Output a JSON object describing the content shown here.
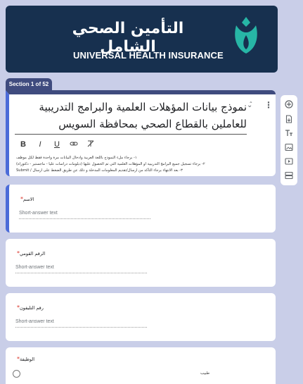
{
  "banner": {
    "arabic_title": "التأمين الصحي الشامل",
    "english_title": "UNIVERSAL HEALTH INSURANCE",
    "logo_icon": "uhi-logo-icon"
  },
  "section_tab": "Section 1 of 52",
  "form": {
    "title": "نموذج بيانات المؤهلات العلمية والبرامج التدريبية للعاملين بالقطاع الصحي بمحافظة السويس",
    "format_buttons": [
      "B",
      "I",
      "U",
      "link",
      "clear"
    ],
    "description_lines": [
      "١- برجاء ملء النموذج باللغة العربية وادخال البيانات مرة واحدة فقط لكل موظف",
      "٢- برجاء تسجيل جميع البرامج التدريبية او المؤهلات العلمية التي تم الحصول عليها (دبلومات دراسات عليا - ماجستير - دكتوراه)",
      "٣- بعد الانتهاء برجاء التأكد من ارسال/تقديم المعلومات المدخلة و ذلك عن طريق الضغط على ارسال / Submit"
    ]
  },
  "questions": [
    {
      "label": "الاسم",
      "placeholder": "Short-answer text"
    },
    {
      "label": "الرقم القومي",
      "placeholder": "Short-answer text"
    },
    {
      "label": "رقم التليفون",
      "placeholder": "Short-answer text"
    },
    {
      "label": "الوظيفة"
    }
  ],
  "option_label": "طبيب",
  "toolbar": [
    "add-question-icon",
    "import-questions-icon",
    "add-title-icon",
    "add-image-icon",
    "add-video-icon",
    "add-section-icon"
  ],
  "colors": {
    "banner_bg": "#17304f",
    "accent": "#3f4b7e",
    "active_border": "#4b6bd8",
    "page_bg": "#c9cee8",
    "logo_teal": "#27b6a6"
  }
}
